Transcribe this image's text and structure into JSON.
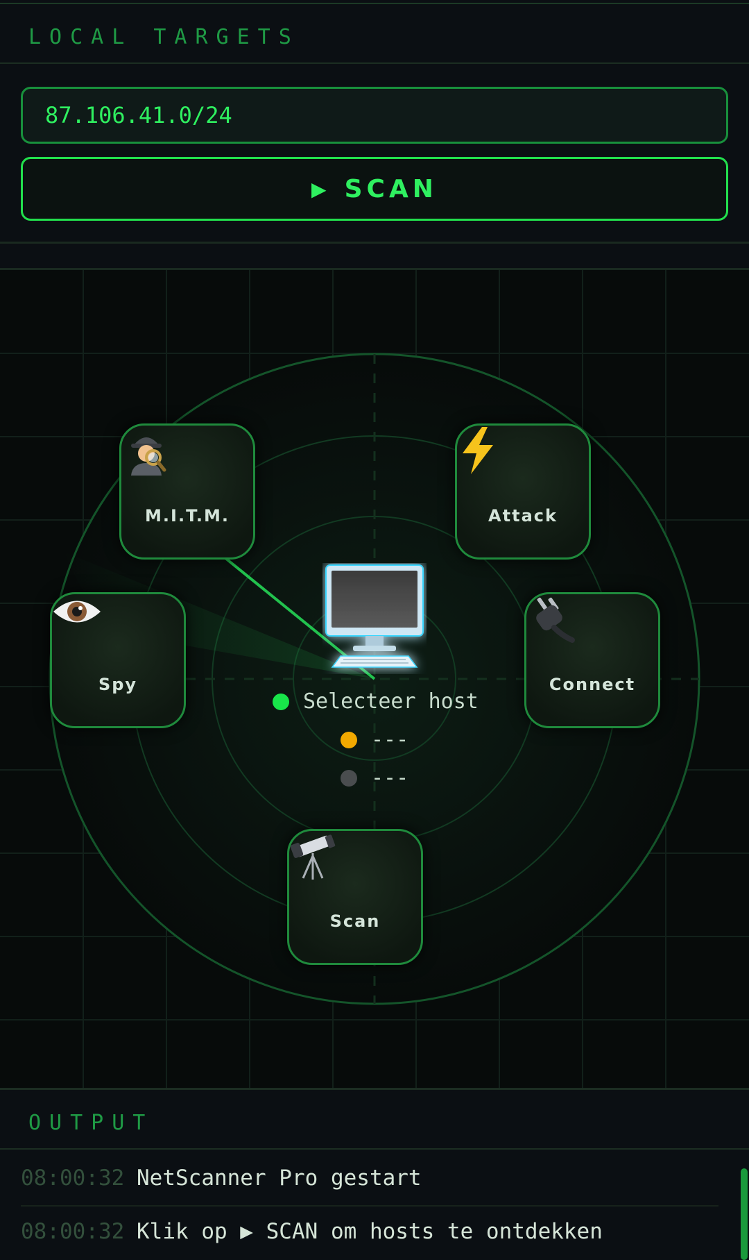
{
  "targets": {
    "title": "LOCAL TARGETS",
    "ip_value": "87.106.41.0/24",
    "scan_play": "▶",
    "scan_label": "SCAN"
  },
  "radar": {
    "buttons": {
      "mitm": {
        "icon": "detective-icon",
        "label": "M.I.T.M."
      },
      "attack": {
        "icon": "lightning-icon",
        "label": "Attack"
      },
      "spy": {
        "icon": "eye-icon",
        "label": "Spy"
      },
      "connect": {
        "icon": "plug-icon",
        "label": "Connect"
      },
      "scan": {
        "icon": "telescope-icon",
        "label": "Scan"
      }
    },
    "center_icon": "computer-icon",
    "status": {
      "host": "Selecteer host",
      "line2": "---",
      "line3": "---"
    },
    "colors": {
      "accent": "#2ff060",
      "host_dot": "#18e64a",
      "warn_dot": "#f2a900",
      "idle_dot": "#4a4d4f"
    }
  },
  "output": {
    "title": "OUTPUT",
    "logs": [
      {
        "time": "08:00:32",
        "message": "NetScanner Pro gestart"
      },
      {
        "time": "08:00:32",
        "message": "Klik op ▶ SCAN om hosts te ontdekken"
      }
    ]
  }
}
